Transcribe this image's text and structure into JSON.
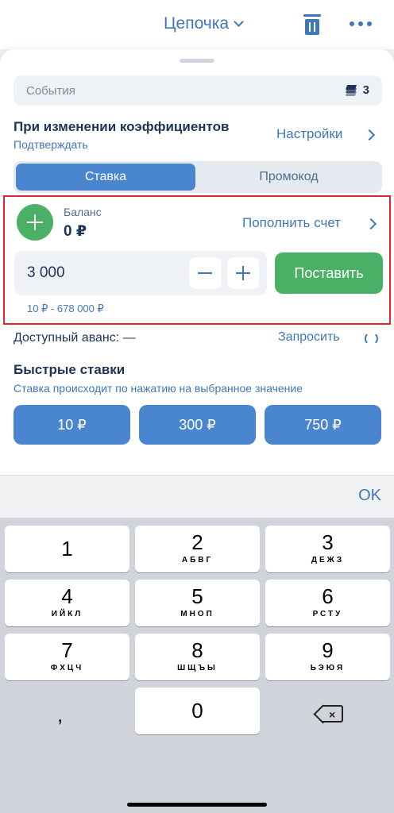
{
  "header": {
    "title": "Цепочка"
  },
  "events": {
    "label": "События",
    "count": "3"
  },
  "odds": {
    "title": "При изменении коэффициентов",
    "subtitle": "Подтверждать",
    "settings_label": "Настройки"
  },
  "tabs": [
    {
      "label": "Ставка",
      "active": true
    },
    {
      "label": "Промокод",
      "active": false
    }
  ],
  "balance": {
    "label": "Баланс",
    "value": "0 ₽",
    "topup_label": "Пополнить счет"
  },
  "bet": {
    "amount": "3 000",
    "place_label": "Поставить",
    "range": "10 ₽ - 678 000 ₽"
  },
  "advance": {
    "label": "Доступный аванс: —",
    "request_label": "Запросить"
  },
  "quick_bets": {
    "title": "Быстрые ставки",
    "subtitle": "Ставка происходит по нажатию на выбранное значение",
    "values": [
      "10 ₽",
      "300 ₽",
      "750 ₽"
    ]
  },
  "keyboard": {
    "ok_label": "OK",
    "keys": [
      {
        "num": "1",
        "letters": ""
      },
      {
        "num": "2",
        "letters": "АБВГ"
      },
      {
        "num": "3",
        "letters": "ДЕЖЗ"
      },
      {
        "num": "4",
        "letters": "ИЙКЛ"
      },
      {
        "num": "5",
        "letters": "МНОП"
      },
      {
        "num": "6",
        "letters": "РСТУ"
      },
      {
        "num": "7",
        "letters": "ФХЦЧ"
      },
      {
        "num": "8",
        "letters": "ШЩЪЫ"
      },
      {
        "num": "9",
        "letters": "ЬЭЮЯ"
      },
      {
        "num": "0",
        "letters": ""
      }
    ],
    "comma": ","
  },
  "colors": {
    "accent": "#4a86cf",
    "link": "#3f78b8",
    "success": "#4ab065",
    "highlight": "#e3242b"
  }
}
